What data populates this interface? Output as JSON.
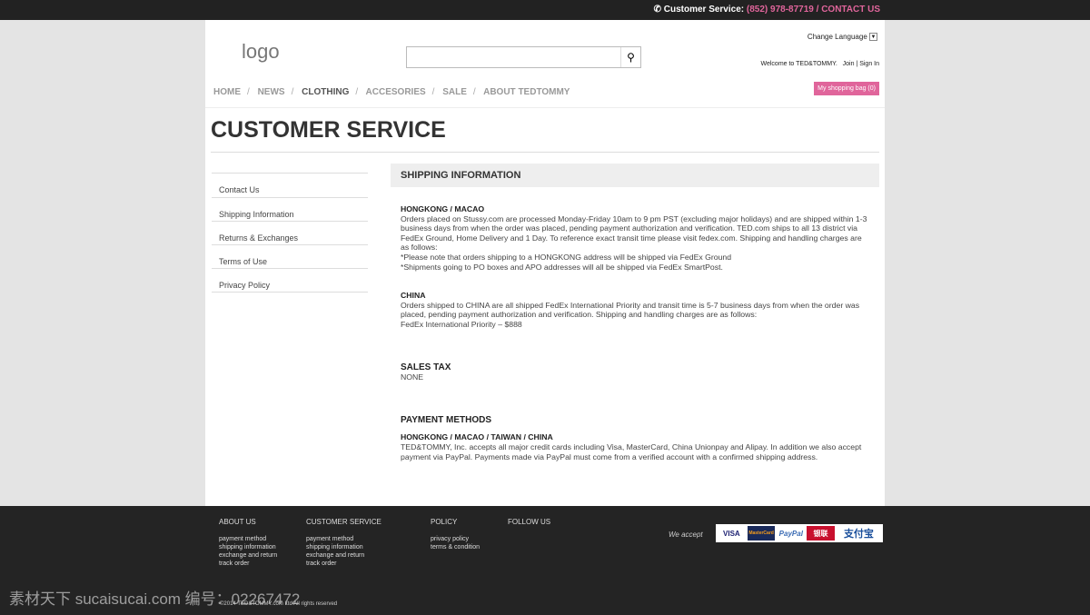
{
  "topbar": {
    "phone_icon": "phone-icon",
    "label": "Customer Service:",
    "phone": "(852) 978-87719",
    "sep": " / ",
    "contact": "CONTACT US"
  },
  "header": {
    "logo": "logo",
    "search_placeholder": "",
    "search_icon": "search-icon",
    "language": "Change Language",
    "welcome": "Welcome to TED&TOMMY.",
    "join": "Join",
    "signin": "Sign In",
    "bag": "My shopping bag (0)"
  },
  "nav": [
    "HOME",
    "NEWS",
    "CLOTHING",
    "ACCESORIES",
    "SALE",
    "ABOUT TEDTOMMY"
  ],
  "page_title": "CUSTOMER SERVICE",
  "sidebar": [
    "Contact Us",
    "Shipping Information",
    "Returns & Exchanges",
    "Terms of Use",
    "Privacy Policy"
  ],
  "main": {
    "heading": "SHIPPING INFORMATION",
    "hk_title": "HONGKONG / MACAO",
    "hk_text": "Orders placed on Stussy.com are processed Monday-Friday 10am to 9 pm PST (excluding major holidays) and are shipped within 1-3 business days from when the order was placed, pending payment authorization and verification. TED.com ships to all  13 district via FedEx Ground, Home Delivery and 1 Day. To reference exact transit time please visit fedex.com. Shipping and handling charges are as follows:",
    "hk_note1": "*Please note that orders shipping to a HONGKONG address will be shipped via FedEx Ground",
    "hk_note2": "*Shipments going to PO boxes and APO addresses will all be shipped via FedEx SmartPost.",
    "cn_title": "CHINA",
    "cn_text": "Orders shipped to CHINA are all shipped FedEx International Priority and transit time is 5-7 business days from when the order was placed, pending payment authorization and verification. Shipping and handling charges are as follows:",
    "cn_price": "FedEx International Priority – $888",
    "tax_title": "SALES TAX",
    "tax_text": "NONE",
    "pay_title": "PAYMENT METHODS",
    "pay_sub": "HONGKONG / MACAO / TAIWAN / CHINA",
    "pay_text": "TED&TOMMY, Inc. accepts all major credit cards including Visa, MasterCard, China Unionpay and Alipay. In addition we also accept payment via PayPal. Payments made via PayPal must come from a verified account with a confirmed shipping address."
  },
  "footer": {
    "about": {
      "title": "ABOUT US",
      "links": [
        "payment method",
        "shipping information",
        "exchange and return",
        "track order"
      ]
    },
    "service": {
      "title": "CUSTOMER SERVICE",
      "links": [
        "payment method",
        "shipping information",
        "exchange and return",
        "track order"
      ]
    },
    "policy": {
      "title": "POLICY",
      "links": [
        "privacy policy",
        "terms & condition"
      ]
    },
    "follow": {
      "title": "FOLLOW US"
    },
    "accept": "We accept",
    "cards": [
      "VISA",
      "MasterCard",
      "PayPal",
      "银联",
      "支付宝"
    ],
    "copyright": "©2014 TED&TOMMY.com Ltd All rights reserved",
    "watermark": "素材天下 sucaisucai.com  编号：02267472"
  },
  "colors": {
    "accent": "#e0659b",
    "topbar": "#222222",
    "footer": "#242424"
  }
}
